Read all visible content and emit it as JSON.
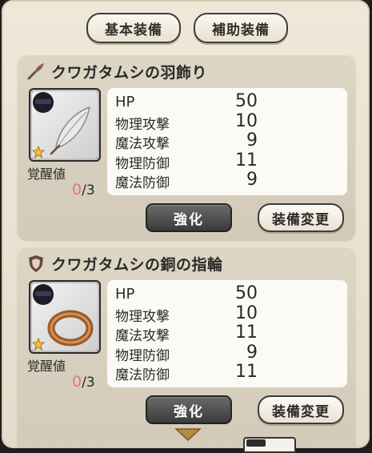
{
  "tabs": [
    {
      "label": "基本装備"
    },
    {
      "label": "補助装備"
    }
  ],
  "equipment": [
    {
      "name": "クワガタムシの羽飾り",
      "type_icon": "feather-category-icon",
      "item_icon": "feather-icon",
      "rarity_icon": "star-icon",
      "awaken_label": "覚醒値",
      "awaken_current": "0",
      "awaken_max": "/3",
      "stats": [
        {
          "name": "HP",
          "value": "50"
        },
        {
          "name": "物理攻撃",
          "value": "10"
        },
        {
          "name": "魔法攻撃",
          "value": "9"
        },
        {
          "name": "物理防御",
          "value": "11"
        },
        {
          "name": "魔法防御",
          "value": "9"
        }
      ],
      "enhance_label": "強化",
      "change_label": "装備変更"
    },
    {
      "name": "クワガタムシの銅の指輪",
      "type_icon": "shield-category-icon",
      "item_icon": "ring-icon",
      "rarity_icon": "star-icon",
      "awaken_label": "覚醒値",
      "awaken_current": "0",
      "awaken_max": "/3",
      "stats": [
        {
          "name": "HP",
          "value": "50"
        },
        {
          "name": "物理攻撃",
          "value": "10"
        },
        {
          "name": "魔法攻撃",
          "value": "11"
        },
        {
          "name": "物理防御",
          "value": "9"
        },
        {
          "name": "魔法防御",
          "value": "11"
        }
      ],
      "enhance_label": "強化",
      "change_label": "装備変更"
    }
  ],
  "colors": {
    "awaken_current": "#e0788a",
    "panel": "#efe8d8",
    "card": "#d8d0bf",
    "dark_button": "#4a4a4a"
  }
}
